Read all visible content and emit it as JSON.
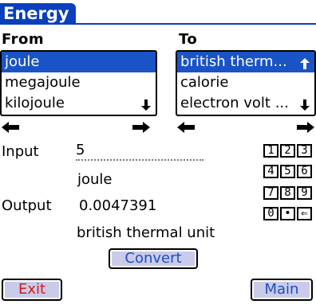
{
  "app": {
    "title": "Energy"
  },
  "from": {
    "header": "From",
    "items": [
      "joule",
      "megajoule",
      "kilojoule"
    ],
    "selected_index": 0
  },
  "to": {
    "header": "To",
    "items": [
      "british therm...",
      "calorie",
      "electron volt ..."
    ],
    "selected_index": 0
  },
  "input": {
    "label": "Input",
    "value": "5",
    "unit": "joule"
  },
  "output": {
    "label": "Output",
    "value": "0.0047391",
    "unit": "british thermal unit"
  },
  "keypad": {
    "keys": [
      "1",
      "2",
      "3",
      "4",
      "5",
      "6",
      "7",
      "8",
      "9",
      "0",
      "•",
      "⇐"
    ]
  },
  "buttons": {
    "convert": "Convert",
    "exit": "Exit",
    "main": "Main"
  },
  "colors": {
    "accent": "#0a3fbd",
    "selection": "#1a53c6",
    "button_face": "#c9cbe8",
    "exit_text": "#d01a1a",
    "main_text": "#1b4fc1"
  }
}
